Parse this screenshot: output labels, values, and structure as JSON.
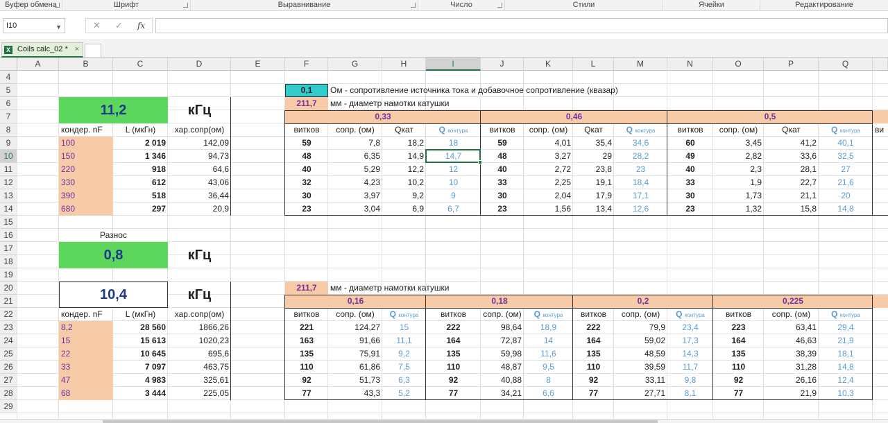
{
  "ribbon": {
    "groups": [
      "Буфер обмена",
      "Шрифт",
      "Выравнивание",
      "Число",
      "Стили",
      "Ячейки",
      "Редактирование"
    ]
  },
  "formula_bar": {
    "name_box": "I10",
    "formula": "",
    "fx": "fx"
  },
  "sheet_tab": {
    "name": "Coils calc_02 *"
  },
  "columns": [
    "A",
    "B",
    "C",
    "D",
    "E",
    "F",
    "G",
    "H",
    "I",
    "J",
    "K",
    "L",
    "M",
    "N",
    "O",
    "P",
    "Q"
  ],
  "rows": [
    "4",
    "5",
    "6",
    "7",
    "8",
    "9",
    "10",
    "11",
    "12",
    "13",
    "14",
    "15",
    "16",
    "17",
    "18",
    "19",
    "20",
    "21",
    "22",
    "23",
    "24",
    "25",
    "26",
    "27",
    "28",
    "29"
  ],
  "selected": {
    "column": "I",
    "row": "10"
  },
  "colors": {
    "green": "#5cd65c",
    "peach": "#f8cba8",
    "teal": "#33cccc",
    "blue_text": "#5b9bd5",
    "purple_text": "#7030a0",
    "excel_green": "#217346"
  },
  "left_top": {
    "freq": "11,2",
    "unit": "кГц",
    "headers": [
      "кондер. nF",
      "L (мкГн)",
      "хар.сопр(ом)"
    ],
    "rows": [
      [
        "100",
        "2 019",
        "142,09"
      ],
      [
        "150",
        "1 346",
        "94,73"
      ],
      [
        "220",
        "918",
        "64,6"
      ],
      [
        "330",
        "612",
        "43,06"
      ],
      [
        "390",
        "518",
        "36,44"
      ],
      [
        "680",
        "297",
        "20,9"
      ]
    ]
  },
  "spread": {
    "label": "Разнос",
    "value": "0,8",
    "unit": "кГц"
  },
  "left_bottom": {
    "freq": "10,4",
    "unit": "кГц",
    "headers": [
      "кондер. nF",
      "L (мкГн)",
      "хар.сопр(ом)"
    ],
    "rows": [
      [
        "8,2",
        "28 560",
        "1866,26"
      ],
      [
        "15",
        "15 613",
        "1020,23"
      ],
      [
        "22",
        "10 645",
        "695,6"
      ],
      [
        "33",
        "7 097",
        "463,75"
      ],
      [
        "47",
        "4 983",
        "325,61"
      ],
      [
        "68",
        "3 444",
        "225,05"
      ]
    ]
  },
  "params": {
    "resistance_value": "0,1",
    "resistance_label": "Ом - сопротивление источника тока и добавочное сопротивление (квазар)",
    "diameter_value": "211,7",
    "diameter_label": "мм - диаметр намотки катушки",
    "diameter2_value": "211,7",
    "diameter2_label": "мм - диаметр намотки катушки"
  },
  "top_table": {
    "groups": [
      "0,33",
      "0,46",
      "0,5"
    ],
    "subheaders": [
      "витков",
      "сопр. (ом)",
      "Qкат",
      "Q",
      "контура"
    ],
    "blocks": [
      [
        [
          "59",
          "7,8",
          "18,2",
          "18"
        ],
        [
          "48",
          "6,35",
          "14,9",
          "14,7"
        ],
        [
          "40",
          "5,29",
          "12,2",
          "12"
        ],
        [
          "32",
          "4,23",
          "10,2",
          "10"
        ],
        [
          "30",
          "3,97",
          "9,2",
          "9"
        ],
        [
          "23",
          "3,04",
          "6,9",
          "6,7"
        ]
      ],
      [
        [
          "59",
          "4,01",
          "35,4",
          "34,6"
        ],
        [
          "48",
          "3,27",
          "29",
          "28,2"
        ],
        [
          "40",
          "2,72",
          "23,8",
          "23"
        ],
        [
          "33",
          "2,25",
          "19,1",
          "18,4"
        ],
        [
          "30",
          "2,04",
          "17,9",
          "17,1"
        ],
        [
          "23",
          "1,56",
          "13,4",
          "12,6"
        ]
      ],
      [
        [
          "60",
          "3,45",
          "41,2",
          "40,1"
        ],
        [
          "49",
          "2,82",
          "33,6",
          "32,5"
        ],
        [
          "40",
          "2,3",
          "28,1",
          "27"
        ],
        [
          "33",
          "1,9",
          "22,7",
          "21,6"
        ],
        [
          "30",
          "1,73",
          "21,1",
          "20"
        ],
        [
          "23",
          "1,32",
          "15,8",
          "14,8"
        ]
      ]
    ],
    "partial_header": "ви"
  },
  "bottom_table": {
    "groups": [
      "0,16",
      "0,18",
      "0,2",
      "0,225"
    ],
    "subheaders": [
      "витков",
      "сопр. (ом)",
      "Q",
      "контура"
    ],
    "blocks": [
      [
        [
          "221",
          "124,27",
          "15"
        ],
        [
          "163",
          "91,66",
          "11,1"
        ],
        [
          "135",
          "75,91",
          "9,2"
        ],
        [
          "110",
          "61,86",
          "7,5"
        ],
        [
          "92",
          "51,73",
          "6,3"
        ],
        [
          "77",
          "43,3",
          "5,2"
        ]
      ],
      [
        [
          "222",
          "98,64",
          "18,9"
        ],
        [
          "164",
          "72,87",
          "14"
        ],
        [
          "135",
          "59,98",
          "11,6"
        ],
        [
          "110",
          "48,87",
          "9,5"
        ],
        [
          "92",
          "40,88",
          "8"
        ],
        [
          "77",
          "34,21",
          "6,6"
        ]
      ],
      [
        [
          "222",
          "79,9",
          "23,4"
        ],
        [
          "164",
          "59,02",
          "17,3"
        ],
        [
          "135",
          "48,59",
          "14,3"
        ],
        [
          "110",
          "39,59",
          "11,7"
        ],
        [
          "92",
          "33,11",
          "9,8"
        ],
        [
          "77",
          "27,71",
          "8,1"
        ]
      ],
      [
        [
          "223",
          "63,41",
          "29,4"
        ],
        [
          "164",
          "46,63",
          "21,9"
        ],
        [
          "135",
          "38,39",
          "18,1"
        ],
        [
          "110",
          "31,28",
          "14,8"
        ],
        [
          "92",
          "26,16",
          "12,4"
        ],
        [
          "77",
          "21,9",
          "10,3"
        ]
      ]
    ]
  }
}
